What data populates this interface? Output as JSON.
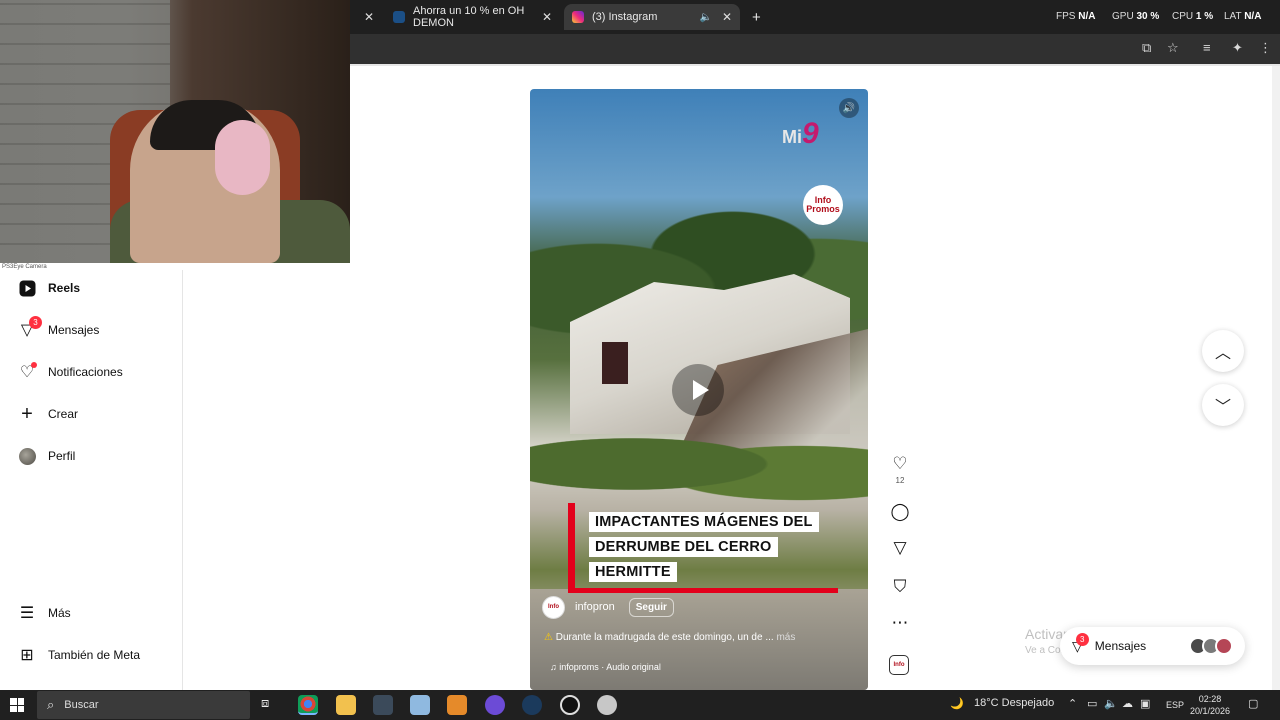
{
  "browser": {
    "tabs": [
      {
        "label": "Ahorra un 10 % en OH DEMON",
        "icon": "steam-icon"
      },
      {
        "label": "(3) Instagram",
        "icon": "instagram-icon",
        "active": true
      }
    ],
    "new_tab_label": "+",
    "close_label": "✕",
    "perf": {
      "fps_label": "FPS",
      "fps_value": "N/A",
      "gpu_label": "GPU",
      "gpu_value": "30 %",
      "cpu_label": "CPU",
      "cpu_value": "1 %",
      "lat_label": "LAT",
      "lat_value": "N/A"
    }
  },
  "webcam": {
    "label": "PS3Eye Camera"
  },
  "sidenav": {
    "items": [
      {
        "label": "Reels",
        "icon": "reels-icon",
        "active": true
      },
      {
        "label": "Mensajes",
        "icon": "messenger-icon",
        "badge": "3"
      },
      {
        "label": "Notificaciones",
        "icon": "heart-icon",
        "dot": true
      },
      {
        "label": "Crear",
        "icon": "plus-icon"
      },
      {
        "label": "Perfil",
        "icon": "avatar"
      },
      {
        "label": "Más",
        "icon": "menu-icon"
      },
      {
        "label": "También de Meta",
        "icon": "meta-grid-icon"
      }
    ]
  },
  "reel": {
    "channel_logo_text": "Mi",
    "channel_logo_num": "9",
    "info_logo_text": "Info Promos",
    "caption_lines": [
      "IMPACTANTES MÁGENES DEL",
      "DERRUMBE DEL CERRO",
      "HERMITTE"
    ],
    "author": "infopron",
    "follow_label": "Seguir",
    "description": "Durante la madrugada de este domingo, un de ...",
    "more_label": "más",
    "audio": "infoproms · Audio original"
  },
  "actions": {
    "like_count": "12"
  },
  "windows": {
    "activate_title": "Activar Windows",
    "activate_sub": "Ve a Configuración para activar"
  },
  "messages_pill": {
    "label": "Mensajes",
    "badge": "3"
  },
  "taskbar": {
    "search_placeholder": "Buscar",
    "weather": "18°C  Despejado",
    "lang": "ESP",
    "time": "02:28",
    "date": "20/1/2026"
  },
  "colors": {
    "accent_red": "#e3001b",
    "badge_red": "#ff3040",
    "chrome_dark": "#1f1f1f"
  }
}
